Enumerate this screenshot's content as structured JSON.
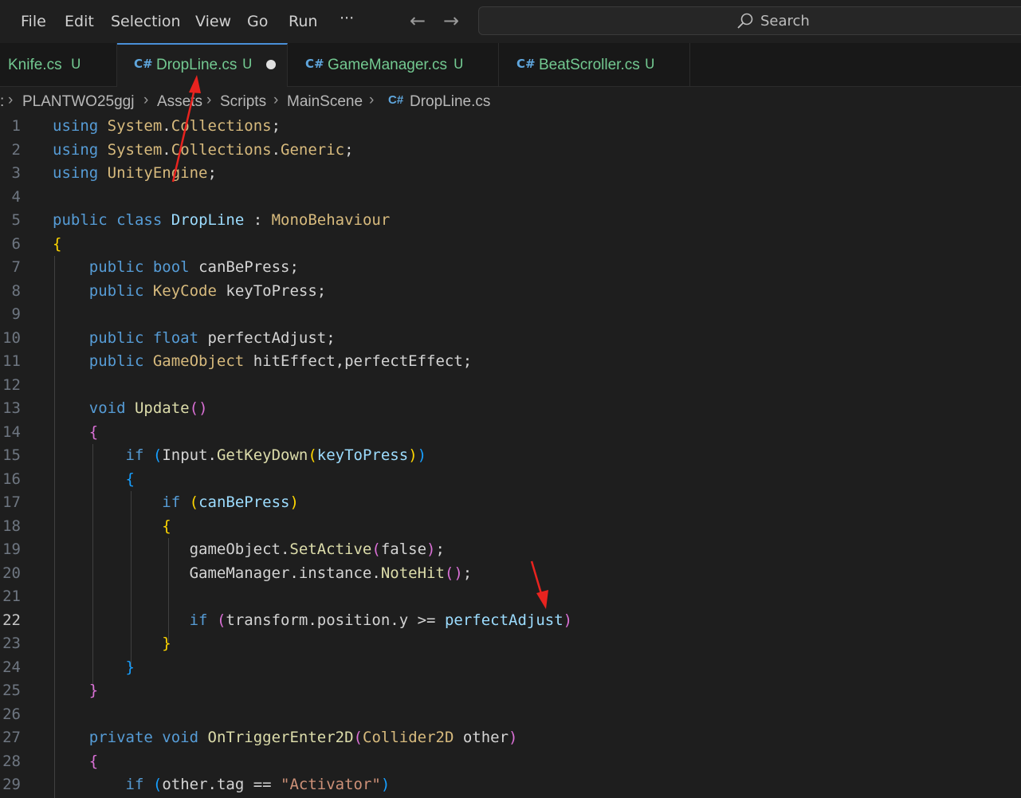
{
  "menu": {
    "file": "File",
    "edit": "Edit",
    "selection": "Selection",
    "view": "View",
    "go": "Go",
    "run": "Run",
    "more": "···"
  },
  "nav": {
    "back": "←",
    "forward": "→"
  },
  "search": {
    "label": "Search"
  },
  "tabs": [
    {
      "icon": "",
      "label": "Knife.cs",
      "status": "U"
    },
    {
      "icon": "C#",
      "label": "DropLine.cs",
      "status": "U",
      "modified": true
    },
    {
      "icon": "C#",
      "label": "GameManager.cs",
      "status": "U"
    },
    {
      "icon": "C#",
      "label": "BeatScroller.cs",
      "status": "U"
    }
  ],
  "breadcrumb": {
    "lead": ":",
    "items": [
      "PLANTWO25ggj",
      "Assets",
      "Scripts",
      "MainScene",
      "DropLine.cs"
    ],
    "file_icon": "C#"
  },
  "editor": {
    "current_line": "22",
    "line_numbers": [
      "1",
      "2",
      "3",
      "4",
      "5",
      "6",
      "7",
      "8",
      "9",
      "10",
      "11",
      "12",
      "13",
      "14",
      "15",
      "16",
      "17",
      "18",
      "19",
      "20",
      "21",
      "22",
      "23",
      "24",
      "25",
      "26",
      "27",
      "28",
      "29"
    ],
    "lines": [
      [
        [
          "kw",
          "using"
        ],
        [
          "pl",
          " "
        ],
        [
          "tyy",
          "System"
        ],
        [
          "pl",
          "."
        ],
        [
          "tyy",
          "Collections"
        ],
        [
          "pl",
          ";"
        ]
      ],
      [
        [
          "kw",
          "using"
        ],
        [
          "pl",
          " "
        ],
        [
          "tyy",
          "System"
        ],
        [
          "pl",
          "."
        ],
        [
          "tyy",
          "Collections"
        ],
        [
          "pl",
          "."
        ],
        [
          "tyy",
          "Generic"
        ],
        [
          "pl",
          ";"
        ]
      ],
      [
        [
          "kw",
          "using"
        ],
        [
          "pl",
          " "
        ],
        [
          "tyy",
          "UnityEngine"
        ],
        [
          "pl",
          ";"
        ]
      ],
      [],
      [
        [
          "kw",
          "public"
        ],
        [
          "pl",
          " "
        ],
        [
          "kw",
          "class"
        ],
        [
          "pl",
          " "
        ],
        [
          "var",
          "DropLine"
        ],
        [
          "pl",
          " : "
        ],
        [
          "tyy",
          "MonoBehaviour"
        ]
      ],
      [
        [
          "b1",
          "{"
        ]
      ],
      [
        [
          "pl",
          "    "
        ],
        [
          "kw",
          "public"
        ],
        [
          "pl",
          " "
        ],
        [
          "kw",
          "bool"
        ],
        [
          "pl",
          " canBePress;"
        ]
      ],
      [
        [
          "pl",
          "    "
        ],
        [
          "kw",
          "public"
        ],
        [
          "pl",
          " "
        ],
        [
          "tyy",
          "KeyCode"
        ],
        [
          "pl",
          " keyToPress;"
        ]
      ],
      [],
      [
        [
          "pl",
          "    "
        ],
        [
          "kw",
          "public"
        ],
        [
          "pl",
          " "
        ],
        [
          "kw",
          "float"
        ],
        [
          "pl",
          " perfectAdjust;"
        ]
      ],
      [
        [
          "pl",
          "    "
        ],
        [
          "kw",
          "public"
        ],
        [
          "pl",
          " "
        ],
        [
          "tyy",
          "GameObject"
        ],
        [
          "pl",
          " hitEffect,perfectEffect;"
        ]
      ],
      [],
      [
        [
          "pl",
          "    "
        ],
        [
          "kw",
          "void"
        ],
        [
          "pl",
          " "
        ],
        [
          "fn",
          "Update"
        ],
        [
          "b2",
          "()"
        ]
      ],
      [
        [
          "pl",
          "    "
        ],
        [
          "b2",
          "{"
        ]
      ],
      [
        [
          "pl",
          "        "
        ],
        [
          "kw",
          "if"
        ],
        [
          "pl",
          " "
        ],
        [
          "b3",
          "("
        ],
        [
          "pl",
          "Input."
        ],
        [
          "fn",
          "GetKeyDown"
        ],
        [
          "b1",
          "("
        ],
        [
          "var",
          "keyToPress"
        ],
        [
          "b1",
          ")"
        ],
        [
          "b3",
          ")"
        ]
      ],
      [
        [
          "pl",
          "        "
        ],
        [
          "b3",
          "{"
        ]
      ],
      [
        [
          "pl",
          "            "
        ],
        [
          "kw",
          "if"
        ],
        [
          "pl",
          " "
        ],
        [
          "b1",
          "("
        ],
        [
          "var",
          "canBePress"
        ],
        [
          "b1",
          ")"
        ]
      ],
      [
        [
          "pl",
          "            "
        ],
        [
          "b1",
          "{"
        ]
      ],
      [
        [
          "pl",
          "               gameObject."
        ],
        [
          "fn",
          "SetActive"
        ],
        [
          "b2",
          "("
        ],
        [
          "pl",
          "false"
        ],
        [
          "b2",
          ")"
        ],
        [
          "pl",
          ";"
        ]
      ],
      [
        [
          "pl",
          "               GameManager.instance."
        ],
        [
          "fn",
          "NoteHit"
        ],
        [
          "b2",
          "()"
        ],
        [
          "pl",
          ";"
        ]
      ],
      [],
      [
        [
          "pl",
          "               "
        ],
        [
          "kw",
          "if"
        ],
        [
          "pl",
          " "
        ],
        [
          "b2",
          "("
        ],
        [
          "pl",
          "transform.position.y >= "
        ],
        [
          "var",
          "perfectAdjust"
        ],
        [
          "b2",
          ")"
        ]
      ],
      [
        [
          "pl",
          "            "
        ],
        [
          "b1",
          "}"
        ]
      ],
      [
        [
          "pl",
          "        "
        ],
        [
          "b3",
          "}"
        ]
      ],
      [
        [
          "pl",
          "    "
        ],
        [
          "b2",
          "}"
        ]
      ],
      [],
      [
        [
          "pl",
          "    "
        ],
        [
          "kw",
          "private"
        ],
        [
          "pl",
          " "
        ],
        [
          "kw",
          "void"
        ],
        [
          "pl",
          " "
        ],
        [
          "fn",
          "OnTriggerEnter2D"
        ],
        [
          "b2",
          "("
        ],
        [
          "tyy",
          "Collider2D"
        ],
        [
          "pl",
          " other"
        ],
        [
          "b2",
          ")"
        ]
      ],
      [
        [
          "pl",
          "    "
        ],
        [
          "b2",
          "{"
        ]
      ],
      [
        [
          "pl",
          "        "
        ],
        [
          "kw",
          "if"
        ],
        [
          "pl",
          " "
        ],
        [
          "b3",
          "("
        ],
        [
          "pl",
          "other.tag == "
        ],
        [
          "str",
          "\"Activator\""
        ],
        [
          "b3",
          ")"
        ]
      ]
    ]
  },
  "colors": {
    "accent": "#4a90d9",
    "untracked": "#73c991",
    "annotation_arrow": "#e8231f"
  },
  "icons": {
    "search": "search-icon",
    "csharp": "csharp-file-icon",
    "modified": "modified-dot-icon",
    "chevron": "chevron-right-icon"
  }
}
